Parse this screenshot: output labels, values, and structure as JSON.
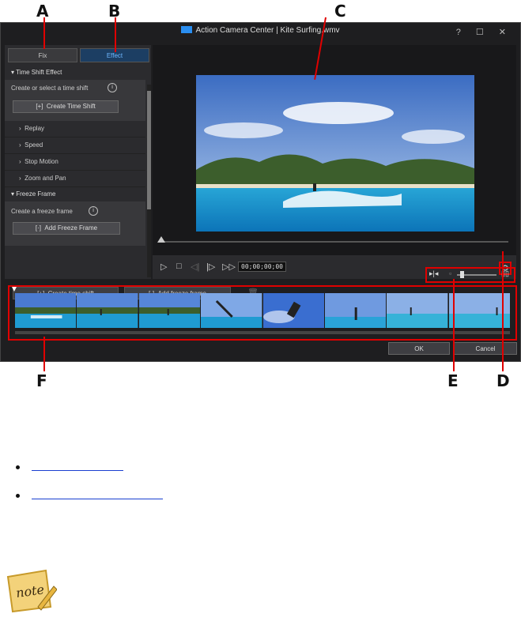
{
  "callouts": {
    "a": "A",
    "b": "B",
    "c": "C",
    "d": "D",
    "e": "E",
    "f": "F"
  },
  "window": {
    "title": "Action Camera Center | Kite Surfing.wmv",
    "controls": "? ☐ ✕"
  },
  "tabs": {
    "fix": "Fix",
    "effect": "Effect"
  },
  "time_shift": {
    "header": "Time Shift Effect",
    "prompt": "Create or select a time shift",
    "create_button": "Create Time Shift",
    "items": [
      "Replay",
      "Speed",
      "Stop Motion",
      "Zoom and Pan"
    ]
  },
  "freeze_frame": {
    "header": "Freeze Frame",
    "prompt": "Create a freeze frame",
    "add_button": "Add Freeze Frame"
  },
  "player": {
    "timecode": "00;00;00;00"
  },
  "toolbar": {
    "create_time_shift": "Create time shift",
    "add_freeze_frame": "Add freeze frame"
  },
  "footer": {
    "ok": "OK",
    "cancel": "Cancel"
  },
  "colors": {
    "accent": "#2a8ef0",
    "callout": "#e00000",
    "panel": "#2b2b2e"
  }
}
